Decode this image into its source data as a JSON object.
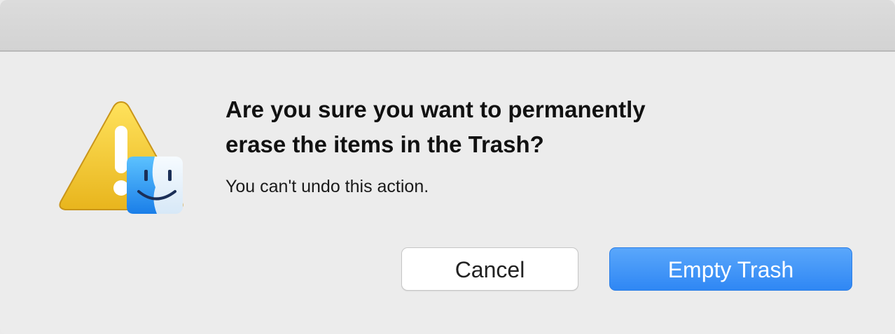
{
  "dialog": {
    "headline": "Are you sure you want to permanently\nerase the items in the Trash?",
    "message": "You can't undo this action.",
    "icon": "warning-finder-icon"
  },
  "buttons": {
    "cancel_label": "Cancel",
    "empty_trash_label": "Empty Trash"
  },
  "colors": {
    "primary_button": "#2f87f4",
    "warning": "#f4c228",
    "finder_blue": "#2f8ef0"
  }
}
